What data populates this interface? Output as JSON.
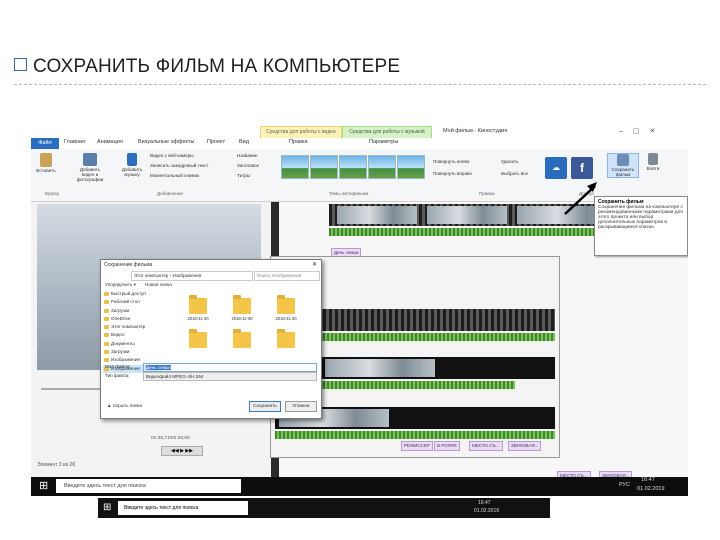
{
  "slide": {
    "title": "СОХРАНИТЬ ФИЛЬМ  НА КОМПЬЮТЕРЕ"
  },
  "window": {
    "title": "Мой фильм - Киностудия",
    "context_tab_video": "Средства для работы с видео",
    "context_tab_music": "Средства для работы с музыкой"
  },
  "tabs": {
    "file": "Файл",
    "items": [
      "Главная",
      "Анимация",
      "Визуальные эффекты",
      "Проект",
      "Вид",
      "Правка",
      "Параметры"
    ]
  },
  "ribbon": {
    "paste": "Вставить",
    "add_video": "Добавить видео и фотографии",
    "add_music": "Добавить музыку",
    "webcam": "Видео с веб-камеры",
    "voiceover": "Записать закадровый текст",
    "snapshot": "Моментальный снимок",
    "caption": "Название",
    "heading": "Заголовок",
    "credits": "Титры",
    "rotate_left": "Повернуть влево",
    "rotate_right": "Повернуть вправо",
    "delete": "Удалить",
    "select_all": "Выбрать все",
    "save_movie": "Сохранить фильм",
    "signin": "Войти",
    "group_clipboard": "Буфер",
    "group_add": "Добавление",
    "group_themes": "Темы автофильма",
    "group_edit": "Правка",
    "group_share": "Доступ"
  },
  "tooltip": {
    "title": "Сохранить фильм",
    "text": "Сохранение фильма на компьютере с рекомендованными параметрами для этого проекта или выбор дополнительных параметров в раскрывающемся списке."
  },
  "timeline": {
    "caption1": "День семьи",
    "caption2": "МЕСТО СЪ...",
    "caption3": "ЗВУКОВАЯ...",
    "captions_small": [
      "РЕЖИССЕР",
      "В РОЛЯХ",
      "МЕСТО СЪ...",
      "ЗВУКОВАЯ..."
    ],
    "timecode": "01:35,71/02:20,00"
  },
  "dialog": {
    "title": "Сохранение фильма",
    "path": [
      "Этот компьютер",
      "Изображения"
    ],
    "search_placeholder": "Поиск: Изображения",
    "organize": "Упорядочить ▾",
    "new_folder": "Новая папка",
    "nav_items": [
      "Быстрый доступ",
      "Рабочий стол",
      "Загрузки",
      "OneDrive",
      "Этот компьютер",
      "Видео",
      "Документы",
      "Загрузки",
      "Изображения",
      "Изображения"
    ],
    "folders": [
      "2018-11-30",
      "2018-11-30",
      "2018-11-30",
      "",
      "",
      ""
    ],
    "filename_label": "Имя файла:",
    "filename_value": "День семьи",
    "filetype_label": "Тип файла:",
    "filetype_value": "Видеофайл MPEG-4/H.264",
    "hide_folders": "▲ Скрыть папки",
    "save_button": "Сохранить",
    "cancel_button": "Отмена"
  },
  "status": {
    "element": "Элемент 3 из 20"
  },
  "taskbar": {
    "search_placeholder": "Введите здесь текст для поиска",
    "lang": "РУС",
    "time": "16:47",
    "date": "01.02.2019"
  },
  "colors": {
    "accent": "#2a6dbf",
    "caption_bg": "#eadcf5",
    "folder": "#f3c649"
  }
}
